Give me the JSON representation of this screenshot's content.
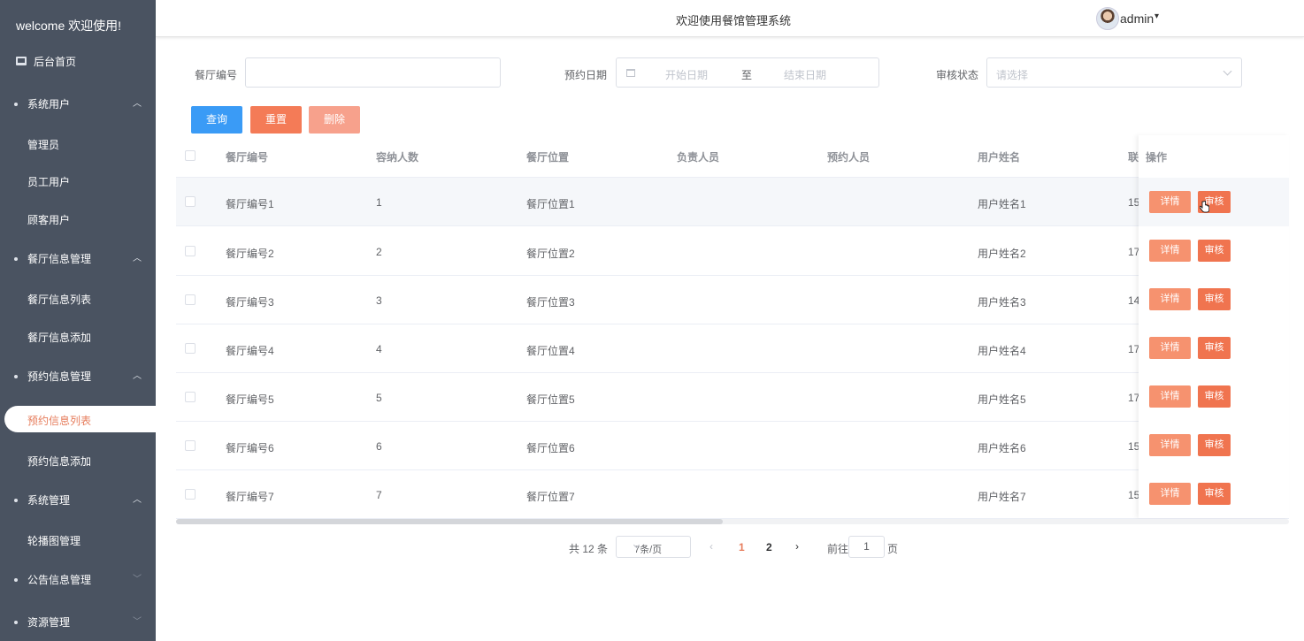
{
  "sidebar": {
    "welcome": "welcome 欢迎使用!",
    "home": "后台首页",
    "groups": [
      {
        "label": "系统用户",
        "items": [
          "管理员",
          "员工用户",
          "顾客用户"
        ]
      },
      {
        "label": "餐厅信息管理",
        "items": [
          "餐厅信息列表",
          "餐厅信息添加"
        ]
      },
      {
        "label": "预约信息管理",
        "items": [
          "预约信息列表",
          "预约信息添加"
        ]
      },
      {
        "label": "系统管理",
        "items": [
          "轮播图管理"
        ]
      },
      {
        "label": "公告信息管理",
        "items": []
      },
      {
        "label": "资源管理",
        "items": []
      }
    ],
    "active_item": "预约信息列表",
    "accent_color": "#e67c5b"
  },
  "header": {
    "title": "欢迎使用餐馆管理系统",
    "user": "admin"
  },
  "search": {
    "restaurant_no_label": "餐厅编号",
    "restaurant_no_value": "",
    "date_label": "预约日期",
    "date_start_placeholder": "开始日期",
    "date_sep": "至",
    "date_end_placeholder": "结束日期",
    "status_label": "审核状态",
    "status_placeholder": "请选择"
  },
  "buttons": {
    "query": "查询",
    "reset": "重置",
    "delete": "删除"
  },
  "table": {
    "columns": [
      "餐厅编号",
      "容纳人数",
      "餐厅位置",
      "负责人员",
      "预约人员",
      "用户姓名",
      "联",
      "操作"
    ],
    "rows": [
      {
        "no": "餐厅编号1",
        "capacity": "1",
        "location": "餐厅位置1",
        "staff": "",
        "booker": "",
        "user": "用户姓名1",
        "phone": "15"
      },
      {
        "no": "餐厅编号2",
        "capacity": "2",
        "location": "餐厅位置2",
        "staff": "",
        "booker": "",
        "user": "用户姓名2",
        "phone": "17"
      },
      {
        "no": "餐厅编号3",
        "capacity": "3",
        "location": "餐厅位置3",
        "staff": "",
        "booker": "",
        "user": "用户姓名3",
        "phone": "14"
      },
      {
        "no": "餐厅编号4",
        "capacity": "4",
        "location": "餐厅位置4",
        "staff": "",
        "booker": "",
        "user": "用户姓名4",
        "phone": "17"
      },
      {
        "no": "餐厅编号5",
        "capacity": "5",
        "location": "餐厅位置5",
        "staff": "",
        "booker": "",
        "user": "用户姓名5",
        "phone": "17"
      },
      {
        "no": "餐厅编号6",
        "capacity": "6",
        "location": "餐厅位置6",
        "staff": "",
        "booker": "",
        "user": "用户姓名6",
        "phone": "15"
      },
      {
        "no": "餐厅编号7",
        "capacity": "7",
        "location": "餐厅位置7",
        "staff": "",
        "booker": "",
        "user": "用户姓名7",
        "phone": "15"
      }
    ],
    "detail_label": "详情",
    "audit_label": "审核"
  },
  "pagination": {
    "total_text": "共 12 条",
    "page_size": "7条/页",
    "pages": [
      "1",
      "2"
    ],
    "current_page": "1",
    "goto_prefix": "前往",
    "goto_value": "1",
    "goto_suffix": "页"
  }
}
